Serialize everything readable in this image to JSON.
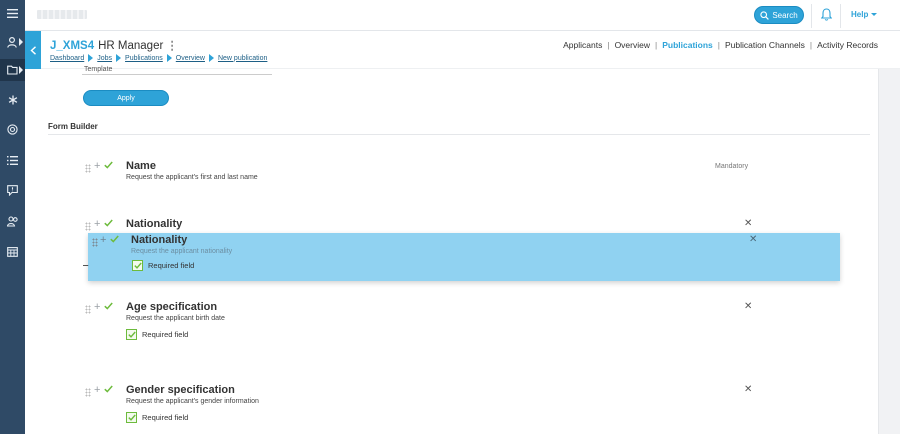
{
  "topbar": {
    "search_label": "Search",
    "help_label": "Help"
  },
  "header": {
    "job_code": "J_XMS4",
    "job_role": "HR Manager",
    "breadcrumb": [
      "Dashboard",
      "Jobs",
      "Publications",
      "Overview",
      "New publication"
    ],
    "nav": [
      {
        "label": "Applicants",
        "active": false
      },
      {
        "label": "Overview",
        "active": false
      },
      {
        "label": "Publications",
        "active": true
      },
      {
        "label": "Publication Channels",
        "active": false
      },
      {
        "label": "Activity Records",
        "active": false
      }
    ]
  },
  "sidebar": {
    "icons": [
      "menu-icon",
      "user-icon",
      "folder-icon",
      "asterisk-icon",
      "target-icon",
      "list-icon",
      "chat-icon",
      "users-icon",
      "calendar-icon"
    ]
  },
  "form": {
    "template_text": "Template",
    "apply_label": "Apply",
    "section_title": "Form Builder",
    "fields": [
      {
        "name": "Name",
        "description": "Request the applicant's first and last name",
        "mandatory_label": "Mandatory",
        "required_label": ""
      },
      {
        "name": "Nationality",
        "description": "",
        "required_label": ""
      },
      {
        "name": "Age specification",
        "description": "Request the applicant birth date",
        "required_label": "Required field"
      },
      {
        "name": "Gender specification",
        "description": "Request the applicant's gender information",
        "required_label": "Required field"
      }
    ],
    "dragged": {
      "name": "Nationality",
      "description": "Request the applicant nationality",
      "required_label": "Required field"
    }
  },
  "colors": {
    "accent": "#2ea3d8",
    "sidebar": "#2f4a66",
    "check": "#6dbb3c"
  }
}
